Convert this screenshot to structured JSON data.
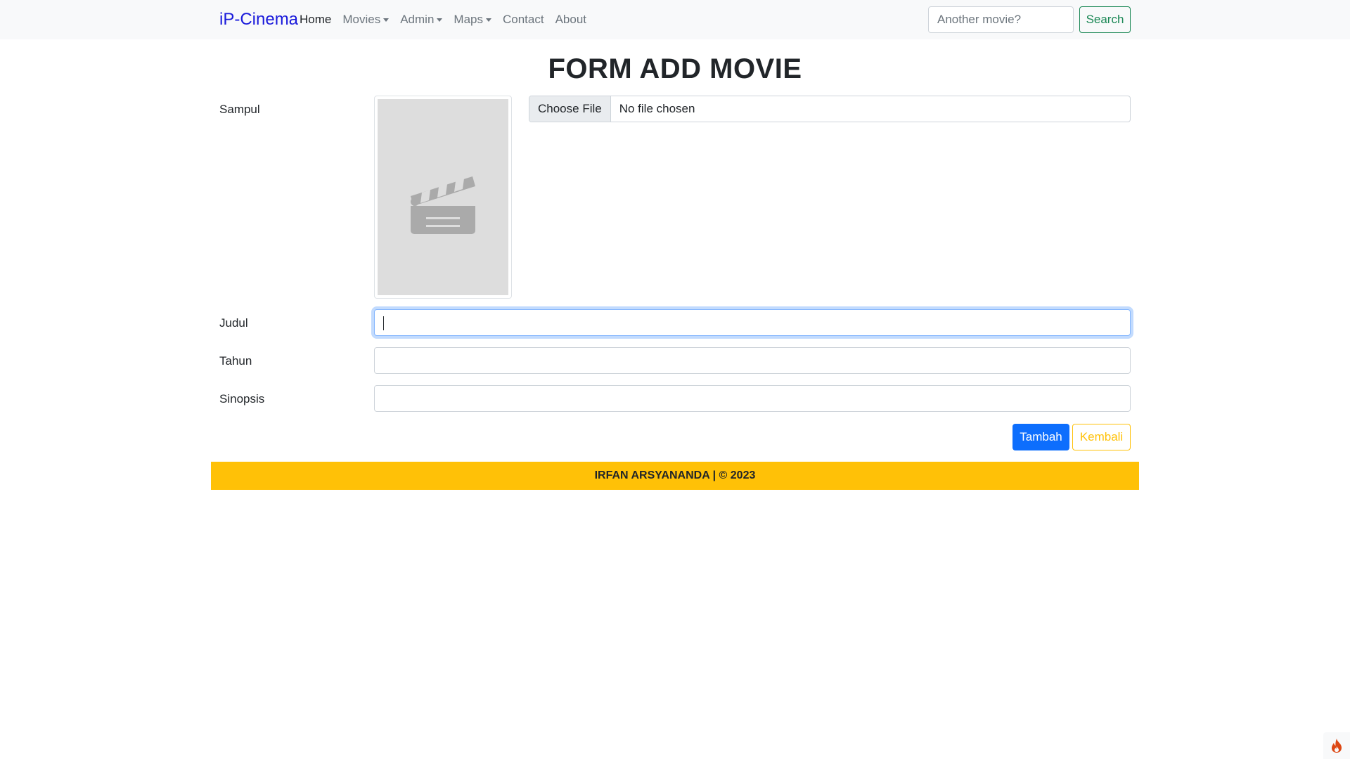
{
  "navbar": {
    "brand": "iP-Cinema",
    "items": [
      {
        "label": "Home",
        "active": true,
        "dropdown": false
      },
      {
        "label": "Movies",
        "active": false,
        "dropdown": true
      },
      {
        "label": "Admin",
        "active": false,
        "dropdown": true
      },
      {
        "label": "Maps",
        "active": false,
        "dropdown": true
      },
      {
        "label": "Contact",
        "active": false,
        "dropdown": false
      },
      {
        "label": "About",
        "active": false,
        "dropdown": false
      }
    ],
    "search_placeholder": "Another movie?",
    "search_button": "Search"
  },
  "form": {
    "title": "FORM ADD MOVIE",
    "cover_label": "Sampul",
    "cover_icon": "clapperboard-icon",
    "file_button": "Choose File",
    "file_status": "No file chosen",
    "title_label": "Judul",
    "title_value": "",
    "year_label": "Tahun",
    "year_value": "",
    "synopsis_label": "Sinopsis",
    "synopsis_value": "",
    "submit_button": "Tambah",
    "back_button": "Kembali"
  },
  "footer": {
    "text": "IRFAN ARSYANANDA | © 2023"
  },
  "corner": {
    "icon": "flame-icon"
  },
  "colors": {
    "brand": "#1a1adb",
    "primary": "#0d6efd",
    "success": "#198754",
    "warning": "#ffc107",
    "navbar_bg": "#f8f9fa"
  }
}
